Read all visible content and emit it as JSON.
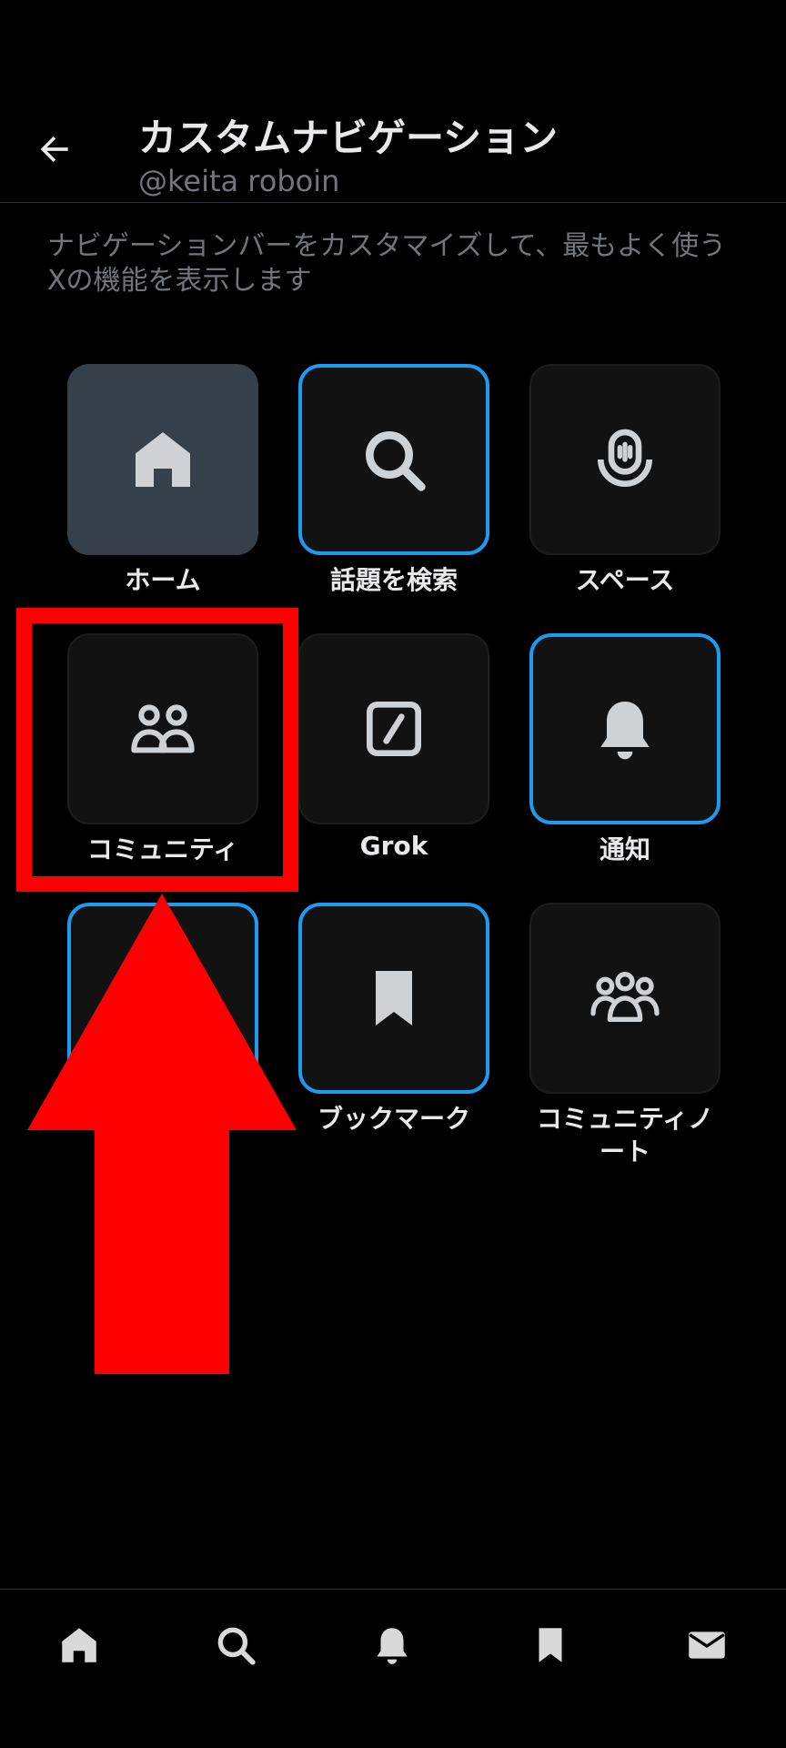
{
  "header": {
    "title": "カスタムナビゲーション",
    "handle": "@keita roboin",
    "back_icon": "arrow-left-icon"
  },
  "description": "ナビゲーションバーをカスタマイズして、最もよく使うXの機能を表示します",
  "tiles": [
    {
      "label": "ホーム",
      "icon": "home-icon",
      "state": "active"
    },
    {
      "label": "話題を検索",
      "icon": "search-icon",
      "state": "selected"
    },
    {
      "label": "スペース",
      "icon": "spaces-icon",
      "state": "normal"
    },
    {
      "label": "コミュニティ",
      "icon": "communities-icon",
      "state": "normal"
    },
    {
      "label": "Grok",
      "icon": "grok-icon",
      "state": "normal"
    },
    {
      "label": "通知",
      "icon": "bell-icon",
      "state": "selected"
    },
    {
      "label": "",
      "icon": "",
      "state": "selected"
    },
    {
      "label": "ブックマーク",
      "icon": "bookmark-icon",
      "state": "selected"
    },
    {
      "label": "コミュニティノート",
      "icon": "community-notes-icon",
      "state": "normal"
    }
  ],
  "bottom_nav": [
    "home-icon",
    "search-icon",
    "bell-icon",
    "bookmark-icon",
    "mail-icon"
  ],
  "colors": {
    "accent": "#1d9bf0",
    "annotation": "#ff0000",
    "background": "#000000"
  }
}
